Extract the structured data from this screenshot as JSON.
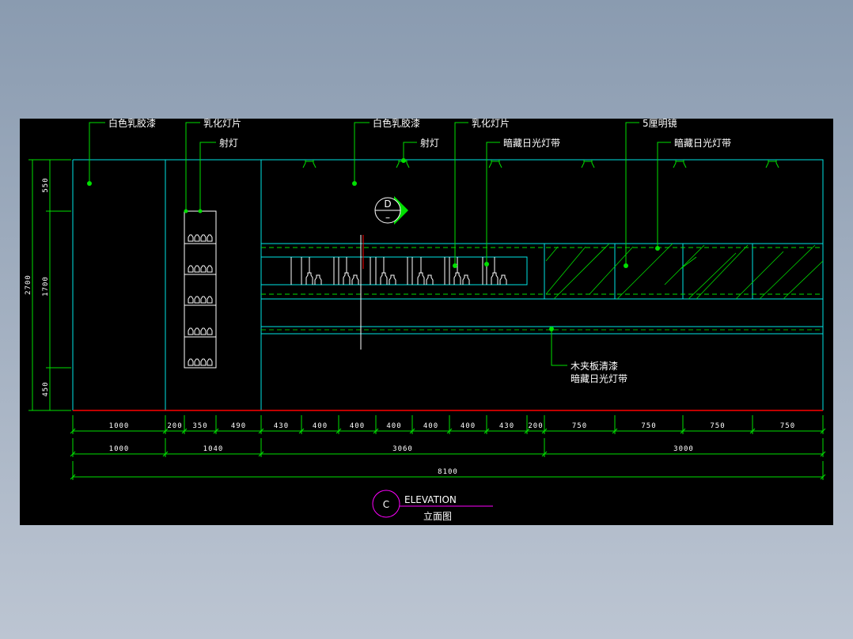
{
  "labels": {
    "paint_left": "白色乳胶漆",
    "lightfilm_left": "乳化灯片",
    "spot_left": "射灯",
    "paint_mid": "白色乳胶漆",
    "spot_mid": "射灯",
    "lightfilm_mid": "乳化灯片",
    "hidden_light_mid": "暗藏日光灯带",
    "mirror": "5厘明镜",
    "hidden_light_right": "暗藏日光灯带",
    "wood_varnish": "木夹板清漆",
    "hidden_light_bottom": "暗藏日光灯带"
  },
  "section_marker": {
    "letter": "D",
    "sub": "–"
  },
  "vertical_dims": {
    "top": "550",
    "middle": "1700",
    "bottom": "450",
    "total": "2700"
  },
  "dims_row1": [
    "1000",
    "200",
    "350",
    "490",
    "430",
    "400",
    "400",
    "400",
    "400",
    "400",
    "430",
    "200",
    "750",
    "750",
    "750",
    "750"
  ],
  "dims_row2": [
    "1000",
    "1040",
    "3060",
    "3000"
  ],
  "dims_row3": [
    "8100"
  ],
  "title": {
    "marker": "C",
    "en": "ELEVATION",
    "cn": "立面图"
  },
  "colors": {
    "wall": "#00e5e5",
    "annotation": "#00e000",
    "floor": "#ff0000",
    "title": "#ff00ff"
  }
}
